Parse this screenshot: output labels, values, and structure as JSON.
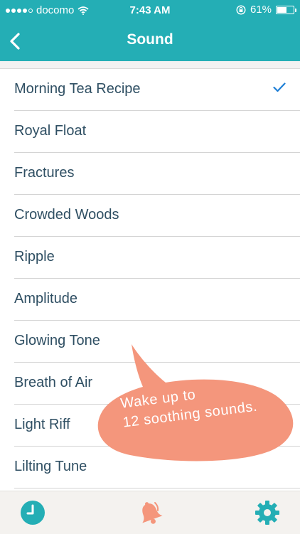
{
  "status": {
    "carrier": "docomo",
    "time": "7:43 AM",
    "battery_percent": "61%",
    "battery_level": 0.61
  },
  "nav": {
    "title": "Sound",
    "back_icon": "chevron-left-icon"
  },
  "sounds": [
    {
      "label": "Morning Tea Recipe",
      "selected": true
    },
    {
      "label": "Royal Float",
      "selected": false
    },
    {
      "label": "Fractures",
      "selected": false
    },
    {
      "label": "Crowded Woods",
      "selected": false
    },
    {
      "label": "Ripple",
      "selected": false
    },
    {
      "label": "Amplitude",
      "selected": false
    },
    {
      "label": "Glowing Tone",
      "selected": false
    },
    {
      "label": "Breath of Air",
      "selected": false
    },
    {
      "label": "Light Riff",
      "selected": false
    },
    {
      "label": "Lilting Tune",
      "selected": false
    }
  ],
  "promo": {
    "line1": "Wake up to",
    "line2": "12 soothing sounds."
  },
  "tabs": [
    {
      "icon": "clock-icon",
      "active": false
    },
    {
      "icon": "bell-icon",
      "active": true
    },
    {
      "icon": "gear-icon",
      "active": false
    }
  ],
  "colors": {
    "accent": "#24aeb5",
    "bubble": "#f4967c",
    "check": "#1e7fd6",
    "text": "#2f4f63"
  }
}
